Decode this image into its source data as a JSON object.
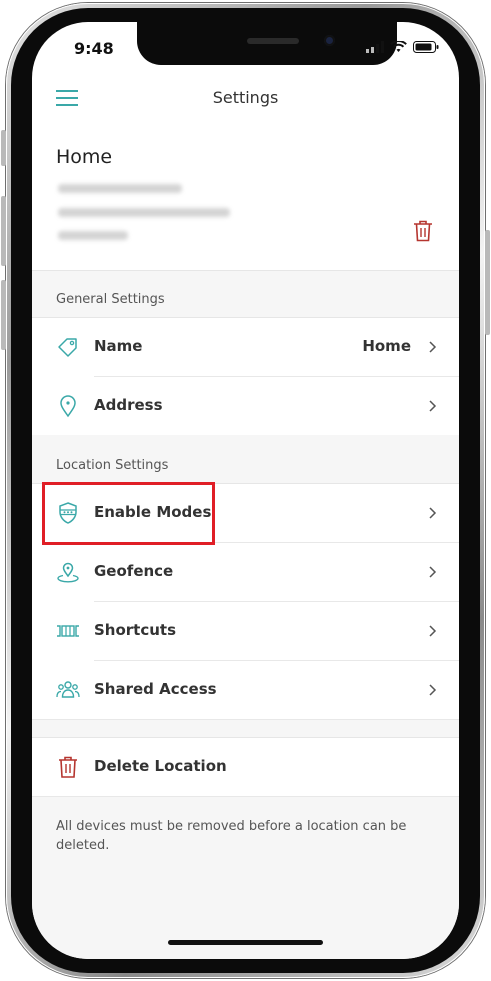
{
  "status_bar": {
    "time": "9:48"
  },
  "header": {
    "title": "Settings",
    "menu_icon": "hamburger-menu-icon"
  },
  "location": {
    "name": "Home"
  },
  "sections": {
    "general": "General Settings",
    "location": "Location Settings"
  },
  "general_rows": {
    "name": {
      "label": "Name",
      "value": "Home",
      "icon": "tag-icon"
    },
    "address": {
      "label": "Address",
      "icon": "location-pin-icon"
    }
  },
  "location_rows": {
    "enable_modes": {
      "label": "Enable Modes",
      "icon": "shield-modes-icon"
    },
    "geofence": {
      "label": "Geofence",
      "icon": "geofence-icon"
    },
    "shortcuts": {
      "label": "Shortcuts",
      "icon": "shortcuts-icon"
    },
    "shared_access": {
      "label": "Shared Access",
      "icon": "people-icon"
    }
  },
  "delete": {
    "label": "Delete Location",
    "icon": "trash-icon"
  },
  "note": "All devices must be removed before a location can be deleted.",
  "colors": {
    "accent": "#3aa8a8",
    "danger": "#b5352f",
    "highlight": "#e01e26"
  }
}
